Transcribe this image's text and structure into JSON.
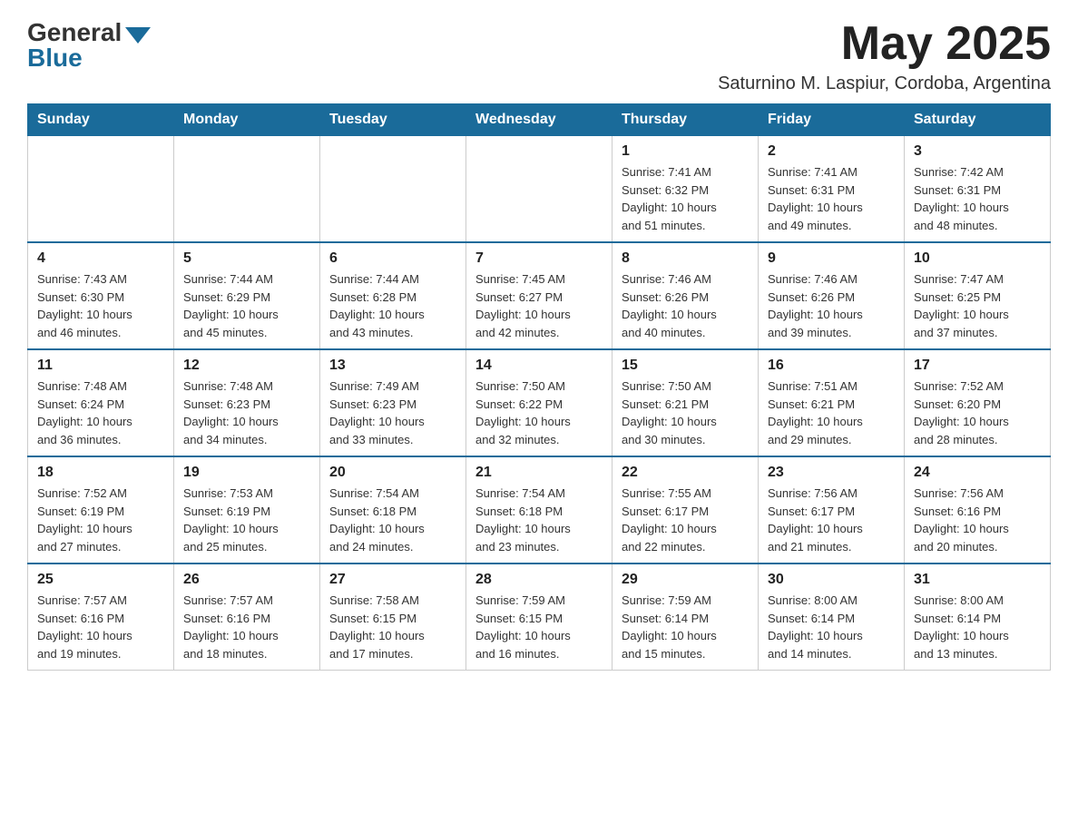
{
  "header": {
    "logo_general": "General",
    "logo_blue": "Blue",
    "month_year": "May 2025",
    "subtitle": "Saturnino M. Laspiur, Cordoba, Argentina"
  },
  "days_of_week": [
    "Sunday",
    "Monday",
    "Tuesday",
    "Wednesday",
    "Thursday",
    "Friday",
    "Saturday"
  ],
  "weeks": [
    [
      {
        "day": "",
        "info": ""
      },
      {
        "day": "",
        "info": ""
      },
      {
        "day": "",
        "info": ""
      },
      {
        "day": "",
        "info": ""
      },
      {
        "day": "1",
        "info": "Sunrise: 7:41 AM\nSunset: 6:32 PM\nDaylight: 10 hours\nand 51 minutes."
      },
      {
        "day": "2",
        "info": "Sunrise: 7:41 AM\nSunset: 6:31 PM\nDaylight: 10 hours\nand 49 minutes."
      },
      {
        "day": "3",
        "info": "Sunrise: 7:42 AM\nSunset: 6:31 PM\nDaylight: 10 hours\nand 48 minutes."
      }
    ],
    [
      {
        "day": "4",
        "info": "Sunrise: 7:43 AM\nSunset: 6:30 PM\nDaylight: 10 hours\nand 46 minutes."
      },
      {
        "day": "5",
        "info": "Sunrise: 7:44 AM\nSunset: 6:29 PM\nDaylight: 10 hours\nand 45 minutes."
      },
      {
        "day": "6",
        "info": "Sunrise: 7:44 AM\nSunset: 6:28 PM\nDaylight: 10 hours\nand 43 minutes."
      },
      {
        "day": "7",
        "info": "Sunrise: 7:45 AM\nSunset: 6:27 PM\nDaylight: 10 hours\nand 42 minutes."
      },
      {
        "day": "8",
        "info": "Sunrise: 7:46 AM\nSunset: 6:26 PM\nDaylight: 10 hours\nand 40 minutes."
      },
      {
        "day": "9",
        "info": "Sunrise: 7:46 AM\nSunset: 6:26 PM\nDaylight: 10 hours\nand 39 minutes."
      },
      {
        "day": "10",
        "info": "Sunrise: 7:47 AM\nSunset: 6:25 PM\nDaylight: 10 hours\nand 37 minutes."
      }
    ],
    [
      {
        "day": "11",
        "info": "Sunrise: 7:48 AM\nSunset: 6:24 PM\nDaylight: 10 hours\nand 36 minutes."
      },
      {
        "day": "12",
        "info": "Sunrise: 7:48 AM\nSunset: 6:23 PM\nDaylight: 10 hours\nand 34 minutes."
      },
      {
        "day": "13",
        "info": "Sunrise: 7:49 AM\nSunset: 6:23 PM\nDaylight: 10 hours\nand 33 minutes."
      },
      {
        "day": "14",
        "info": "Sunrise: 7:50 AM\nSunset: 6:22 PM\nDaylight: 10 hours\nand 32 minutes."
      },
      {
        "day": "15",
        "info": "Sunrise: 7:50 AM\nSunset: 6:21 PM\nDaylight: 10 hours\nand 30 minutes."
      },
      {
        "day": "16",
        "info": "Sunrise: 7:51 AM\nSunset: 6:21 PM\nDaylight: 10 hours\nand 29 minutes."
      },
      {
        "day": "17",
        "info": "Sunrise: 7:52 AM\nSunset: 6:20 PM\nDaylight: 10 hours\nand 28 minutes."
      }
    ],
    [
      {
        "day": "18",
        "info": "Sunrise: 7:52 AM\nSunset: 6:19 PM\nDaylight: 10 hours\nand 27 minutes."
      },
      {
        "day": "19",
        "info": "Sunrise: 7:53 AM\nSunset: 6:19 PM\nDaylight: 10 hours\nand 25 minutes."
      },
      {
        "day": "20",
        "info": "Sunrise: 7:54 AM\nSunset: 6:18 PM\nDaylight: 10 hours\nand 24 minutes."
      },
      {
        "day": "21",
        "info": "Sunrise: 7:54 AM\nSunset: 6:18 PM\nDaylight: 10 hours\nand 23 minutes."
      },
      {
        "day": "22",
        "info": "Sunrise: 7:55 AM\nSunset: 6:17 PM\nDaylight: 10 hours\nand 22 minutes."
      },
      {
        "day": "23",
        "info": "Sunrise: 7:56 AM\nSunset: 6:17 PM\nDaylight: 10 hours\nand 21 minutes."
      },
      {
        "day": "24",
        "info": "Sunrise: 7:56 AM\nSunset: 6:16 PM\nDaylight: 10 hours\nand 20 minutes."
      }
    ],
    [
      {
        "day": "25",
        "info": "Sunrise: 7:57 AM\nSunset: 6:16 PM\nDaylight: 10 hours\nand 19 minutes."
      },
      {
        "day": "26",
        "info": "Sunrise: 7:57 AM\nSunset: 6:16 PM\nDaylight: 10 hours\nand 18 minutes."
      },
      {
        "day": "27",
        "info": "Sunrise: 7:58 AM\nSunset: 6:15 PM\nDaylight: 10 hours\nand 17 minutes."
      },
      {
        "day": "28",
        "info": "Sunrise: 7:59 AM\nSunset: 6:15 PM\nDaylight: 10 hours\nand 16 minutes."
      },
      {
        "day": "29",
        "info": "Sunrise: 7:59 AM\nSunset: 6:14 PM\nDaylight: 10 hours\nand 15 minutes."
      },
      {
        "day": "30",
        "info": "Sunrise: 8:00 AM\nSunset: 6:14 PM\nDaylight: 10 hours\nand 14 minutes."
      },
      {
        "day": "31",
        "info": "Sunrise: 8:00 AM\nSunset: 6:14 PM\nDaylight: 10 hours\nand 13 minutes."
      }
    ]
  ]
}
